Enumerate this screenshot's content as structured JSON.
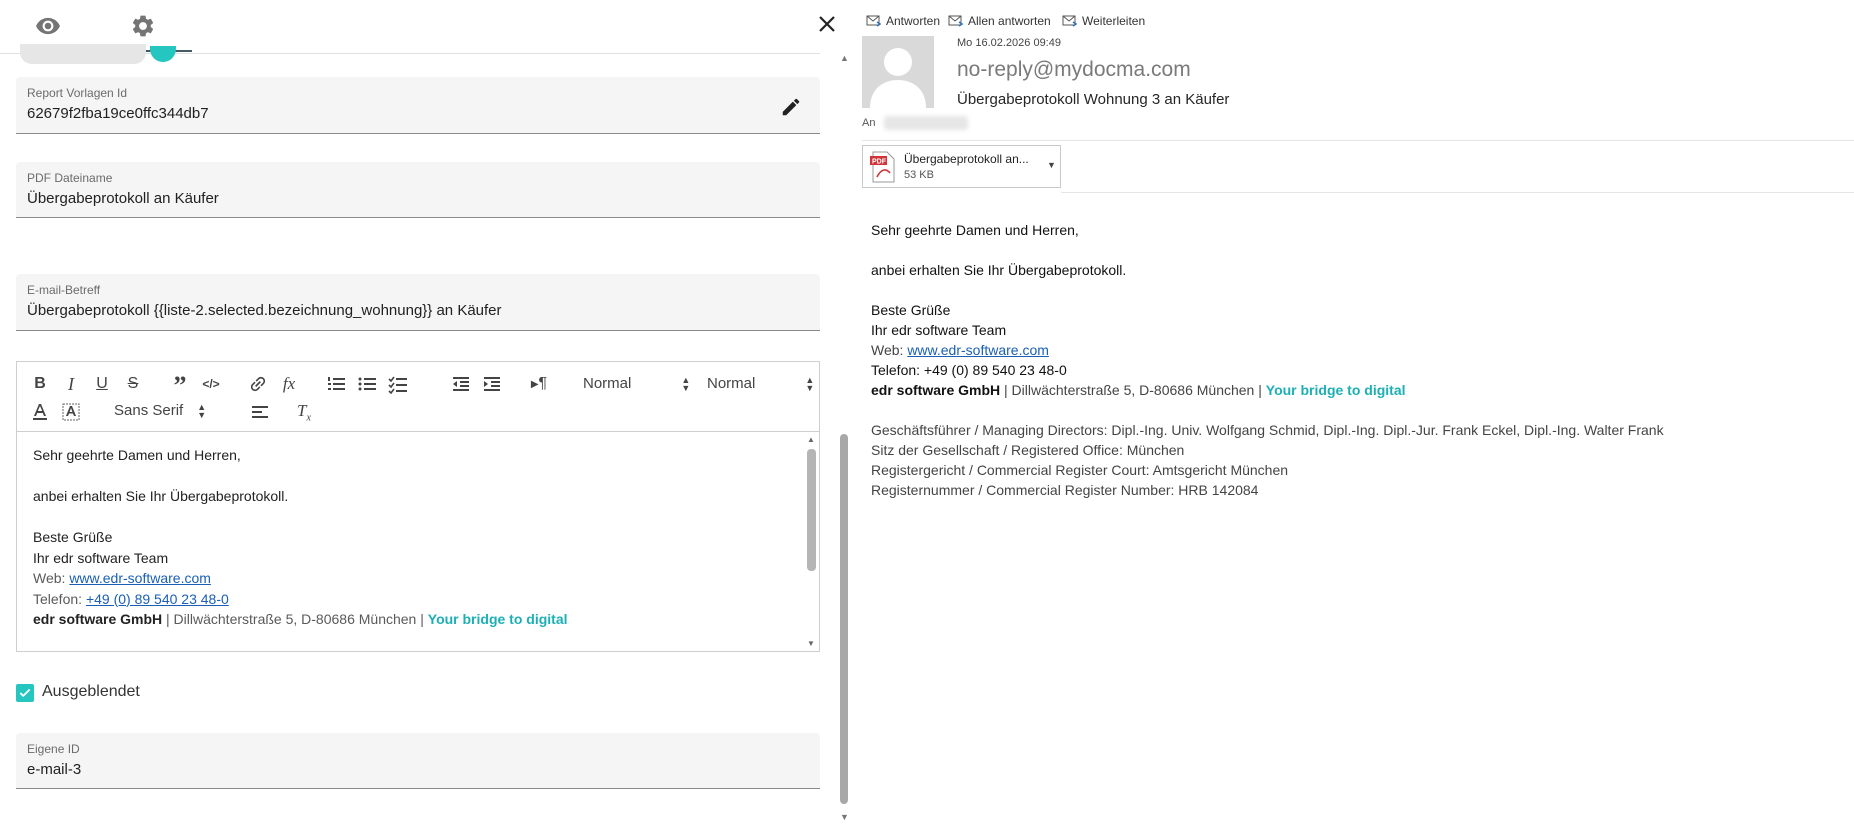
{
  "left": {
    "fields": {
      "report_id": {
        "label": "Report Vorlagen Id",
        "value": "62679f2fba19ce0ffc344db7"
      },
      "pdf_name": {
        "label": "PDF Dateiname",
        "value": "Übergabeprotokoll an Käufer"
      },
      "subject": {
        "label": "E-mail-Betreff",
        "value": "Übergabeprotokoll {{liste-2.selected.bezeichnung_wohnung}} an Käufer"
      },
      "own_id": {
        "label": "Eigene ID",
        "value": "e-mail-3"
      }
    },
    "toolbar": {
      "header_select": "Normal",
      "size_select": "Normal",
      "font_select": "Sans Serif",
      "buttons": {
        "bold": "B",
        "italic": "I",
        "underline": "U",
        "strike": "S",
        "blockquote": "”",
        "code": "</>",
        "formula": "fx",
        "pilcrow": "¶"
      }
    },
    "editor": {
      "greeting": "Sehr geehrte Damen und Herren,",
      "line1": "anbei erhalten Sie Ihr Übergabeprotokoll.",
      "regards": "Beste Grüße",
      "team": "Ihr edr software Team",
      "web_label": "Web: ",
      "web_link": "www.edr-software.com",
      "phone_label": "Telefon: ",
      "phone_link": "+49 (0) 89 540 23 48-0",
      "company": "edr software GmbH",
      "address": " | Dillwächterstraße 5, D-80686 München  | ",
      "slogan": "Your bridge to digital"
    },
    "hidden_checkbox": {
      "label": "Ausgeblendet",
      "checked": true
    }
  },
  "preview": {
    "actions": {
      "reply": "Antworten",
      "reply_all": "Allen antworten",
      "forward": "Weiterleiten"
    },
    "date": "Mo 16.02.2026 09:49",
    "sender": "no-reply@mydocma.com",
    "subject": "Übergabeprotokoll Wohnung 3 an Käufer",
    "to_label": "An",
    "attachment": {
      "name": "Übergabeprotokoll an...",
      "size": "53 KB",
      "type": "PDF"
    },
    "body": {
      "greeting": "Sehr geehrte Damen und Herren,",
      "line1": "anbei erhalten Sie Ihr Übergabeprotokoll.",
      "regards": "Beste Grüße",
      "team": "Ihr edr software Team",
      "web_label": "Web: ",
      "web_link": "www.edr-software.com",
      "phone": "Telefon: +49 (0) 89 540 23 48-0",
      "company": "edr software GmbH",
      "address": " | Dillwächterstraße 5, D-80686 München  | ",
      "slogan": "Your bridge to digital",
      "directors": "Geschäftsführer / Managing Directors: Dipl.-Ing. Univ. Wolfgang Schmid, Dipl.-Ing. Dipl.-Jur. Frank Eckel, Dipl.-Ing. Walter Frank",
      "office": "Sitz der Gesellschaft / Registered Office: München",
      "court": "Registergericht / Commercial Register Court: Amtsgericht München",
      "register": "Registernummer / Commercial Register Number: HRB 142084"
    }
  },
  "colors": {
    "accent": "#26c6c0",
    "slogan": "#1cb0b5",
    "link": "#1a5fb4"
  }
}
